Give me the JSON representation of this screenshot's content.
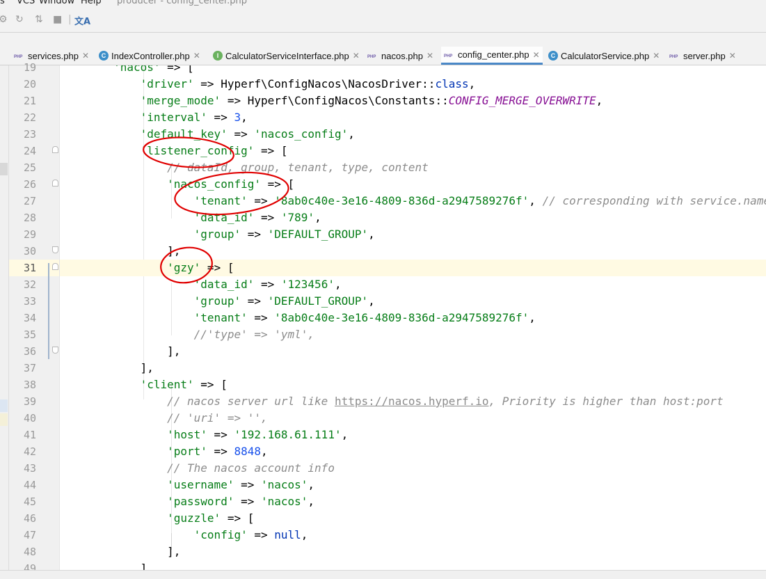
{
  "menu": {
    "items": [
      "s",
      "VCS",
      "Window",
      "Help"
    ],
    "title": "producer - config_center.php"
  },
  "toolbar": {
    "icons": [
      "gear-icon",
      "run-config-icon",
      "vcs-icon",
      "stop-icon",
      "translate-icon"
    ]
  },
  "tabs": [
    {
      "label": "services.php",
      "icon": "php-file-icon",
      "active": false
    },
    {
      "label": "IndexController.php",
      "icon": "class-file-icon",
      "active": false
    },
    {
      "label": "CalculatorServiceInterface.php",
      "icon": "interface-file-icon",
      "active": false
    },
    {
      "label": "nacos.php",
      "icon": "php-file-icon",
      "active": false
    },
    {
      "label": "config_center.php",
      "icon": "php-file-icon",
      "active": true
    },
    {
      "label": "CalculatorService.php",
      "icon": "class-file-icon",
      "active": false
    },
    {
      "label": "server.php",
      "icon": "php-file-icon",
      "active": false
    }
  ],
  "editor": {
    "current_line": 31,
    "lines": [
      {
        "n": "19",
        "tokens": [
          [
            "",
            "        "
          ],
          [
            "s",
            "'nacos'"
          ],
          [
            "",
            " => ["
          ]
        ]
      },
      {
        "n": "20",
        "tokens": [
          [
            "",
            "            "
          ],
          [
            "s",
            "'driver'"
          ],
          [
            "",
            " => Hyperf\\ConfigNacos\\NacosDriver::"
          ],
          [
            "k",
            "class"
          ],
          [
            "",
            ","
          ]
        ]
      },
      {
        "n": "21",
        "tokens": [
          [
            "",
            "            "
          ],
          [
            "s",
            "'merge_mode'"
          ],
          [
            "",
            " => Hyperf\\ConfigNacos\\Constants::"
          ],
          [
            "cn",
            "CONFIG_MERGE_OVERWRITE"
          ],
          [
            "",
            ","
          ]
        ]
      },
      {
        "n": "22",
        "tokens": [
          [
            "",
            "            "
          ],
          [
            "s",
            "'interval'"
          ],
          [
            "",
            " => "
          ],
          [
            "n",
            "3"
          ],
          [
            "",
            ","
          ]
        ]
      },
      {
        "n": "23",
        "tokens": [
          [
            "",
            "            "
          ],
          [
            "s",
            "'default_key'"
          ],
          [
            "",
            " => "
          ],
          [
            "s",
            "'nacos_config'"
          ],
          [
            "",
            ","
          ]
        ]
      },
      {
        "n": "24",
        "tokens": [
          [
            "",
            "            "
          ],
          [
            "s",
            "'listener_config'"
          ],
          [
            "",
            " => ["
          ]
        ]
      },
      {
        "n": "25",
        "tokens": [
          [
            "",
            "                "
          ],
          [
            "cm",
            "// dataId, group, tenant, type, content"
          ]
        ]
      },
      {
        "n": "26",
        "tokens": [
          [
            "",
            "                "
          ],
          [
            "s",
            "'nacos_config'"
          ],
          [
            "",
            " => ["
          ]
        ]
      },
      {
        "n": "27",
        "tokens": [
          [
            "",
            "                    "
          ],
          [
            "s",
            "'tenant'"
          ],
          [
            "",
            " => "
          ],
          [
            "s",
            "'8ab0c40e-3e16-4809-836d-a2947589276f'"
          ],
          [
            "",
            ", "
          ],
          [
            "cm",
            "// corresponding with service.namespaceId"
          ]
        ]
      },
      {
        "n": "28",
        "tokens": [
          [
            "",
            "                    "
          ],
          [
            "s",
            "'data_id'"
          ],
          [
            "",
            " => "
          ],
          [
            "s",
            "'789'"
          ],
          [
            "",
            ","
          ]
        ]
      },
      {
        "n": "29",
        "tokens": [
          [
            "",
            "                    "
          ],
          [
            "s",
            "'group'"
          ],
          [
            "",
            " => "
          ],
          [
            "s",
            "'DEFAULT_GROUP'"
          ],
          [
            "",
            ","
          ]
        ]
      },
      {
        "n": "30",
        "tokens": [
          [
            "",
            "                ],"
          ]
        ]
      },
      {
        "n": "31",
        "tokens": [
          [
            "",
            "                "
          ],
          [
            "s",
            "'gzy'"
          ],
          [
            "",
            " => ["
          ]
        ]
      },
      {
        "n": "32",
        "tokens": [
          [
            "",
            "                    "
          ],
          [
            "s",
            "'data_id'"
          ],
          [
            "",
            " => "
          ],
          [
            "s",
            "'123456'"
          ],
          [
            "",
            ","
          ]
        ]
      },
      {
        "n": "33",
        "tokens": [
          [
            "",
            "                    "
          ],
          [
            "s",
            "'group'"
          ],
          [
            "",
            " => "
          ],
          [
            "s",
            "'DEFAULT_GROUP'"
          ],
          [
            "",
            ","
          ]
        ]
      },
      {
        "n": "34",
        "tokens": [
          [
            "",
            "                    "
          ],
          [
            "s",
            "'tenant'"
          ],
          [
            "",
            " => "
          ],
          [
            "s",
            "'8ab0c40e-3e16-4809-836d-a2947589276f'"
          ],
          [
            "",
            ","
          ]
        ]
      },
      {
        "n": "35",
        "tokens": [
          [
            "",
            "                    "
          ],
          [
            "cm",
            "//'type' => 'yml',"
          ]
        ]
      },
      {
        "n": "36",
        "tokens": [
          [
            "",
            "                ],"
          ]
        ]
      },
      {
        "n": "37",
        "tokens": [
          [
            "",
            "            ],"
          ]
        ]
      },
      {
        "n": "38",
        "tokens": [
          [
            "",
            "            "
          ],
          [
            "s",
            "'client'"
          ],
          [
            "",
            " => ["
          ]
        ]
      },
      {
        "n": "39",
        "tokens": [
          [
            "",
            "                "
          ],
          [
            "cm",
            "// nacos server url like "
          ],
          [
            "u",
            "https://nacos.hyperf.io"
          ],
          [
            "cm",
            ", Priority is higher than host:port"
          ]
        ]
      },
      {
        "n": "40",
        "tokens": [
          [
            "",
            "                "
          ],
          [
            "cm",
            "// 'uri' => '',"
          ]
        ]
      },
      {
        "n": "41",
        "tokens": [
          [
            "",
            "                "
          ],
          [
            "s",
            "'host'"
          ],
          [
            "",
            " => "
          ],
          [
            "s",
            "'192.168.61.111'"
          ],
          [
            "",
            ","
          ]
        ]
      },
      {
        "n": "42",
        "tokens": [
          [
            "",
            "                "
          ],
          [
            "s",
            "'port'"
          ],
          [
            "",
            " => "
          ],
          [
            "n",
            "8848"
          ],
          [
            "",
            ","
          ]
        ]
      },
      {
        "n": "43",
        "tokens": [
          [
            "",
            "                "
          ],
          [
            "cm",
            "// The nacos account info"
          ]
        ]
      },
      {
        "n": "44",
        "tokens": [
          [
            "",
            "                "
          ],
          [
            "s",
            "'username'"
          ],
          [
            "",
            " => "
          ],
          [
            "s",
            "'nacos'"
          ],
          [
            "",
            ","
          ]
        ]
      },
      {
        "n": "45",
        "tokens": [
          [
            "",
            "                "
          ],
          [
            "s",
            "'password'"
          ],
          [
            "",
            " => "
          ],
          [
            "s",
            "'nacos'"
          ],
          [
            "",
            ","
          ]
        ]
      },
      {
        "n": "46",
        "tokens": [
          [
            "",
            "                "
          ],
          [
            "s",
            "'guzzle'"
          ],
          [
            "",
            " => ["
          ]
        ]
      },
      {
        "n": "47",
        "tokens": [
          [
            "",
            "                    "
          ],
          [
            "s",
            "'config'"
          ],
          [
            "",
            " => "
          ],
          [
            "k",
            "null"
          ],
          [
            "",
            ","
          ]
        ]
      },
      {
        "n": "48",
        "tokens": [
          [
            "",
            "                ],"
          ]
        ]
      },
      {
        "n": "49",
        "tokens": [
          [
            "",
            "            ],"
          ]
        ]
      }
    ]
  },
  "annotation_color": "#e00000"
}
